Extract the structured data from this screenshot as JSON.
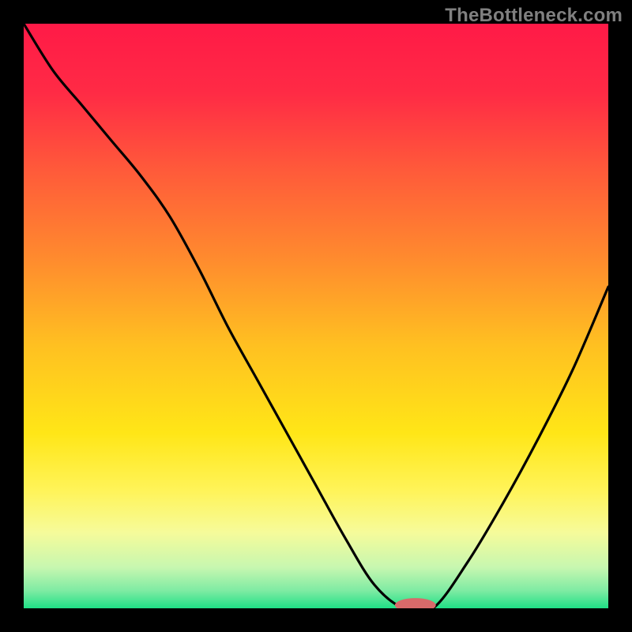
{
  "watermark": "TheBottleneck.com",
  "colors": {
    "frame": "#000000",
    "watermark": "#808080",
    "curve": "#000000",
    "marker_fill": "#d86a6a",
    "gradient_stops": [
      {
        "offset": 0.0,
        "color": "#ff1a47"
      },
      {
        "offset": 0.12,
        "color": "#ff2b45"
      },
      {
        "offset": 0.25,
        "color": "#ff5a3a"
      },
      {
        "offset": 0.4,
        "color": "#ff8a2e"
      },
      {
        "offset": 0.55,
        "color": "#ffc021"
      },
      {
        "offset": 0.7,
        "color": "#ffe617"
      },
      {
        "offset": 0.8,
        "color": "#fff45a"
      },
      {
        "offset": 0.87,
        "color": "#f6fb9a"
      },
      {
        "offset": 0.93,
        "color": "#c7f7b0"
      },
      {
        "offset": 0.97,
        "color": "#7eeba3"
      },
      {
        "offset": 1.0,
        "color": "#1fe086"
      }
    ]
  },
  "chart_data": {
    "type": "line",
    "title": "",
    "xlabel": "",
    "ylabel": "",
    "x": [
      0,
      5,
      10,
      15,
      20,
      25,
      30,
      35,
      40,
      45,
      50,
      55,
      60,
      65,
      70,
      76,
      82,
      88,
      94,
      100
    ],
    "values": [
      100,
      92,
      86,
      80,
      74,
      67,
      58,
      48,
      39,
      30,
      21,
      12,
      4,
      0,
      0,
      8,
      18,
      29,
      41,
      55
    ],
    "xlim": [
      0,
      100
    ],
    "ylim": [
      0,
      100
    ],
    "marker": {
      "x": 67,
      "y": 0,
      "rx": 3.5,
      "ry": 1.2
    },
    "notes": "V-shaped bottleneck curve over vertical red→green heat gradient; minimum (optimal match) around x≈65–70 at y=0. Values approximated from pixel positions."
  }
}
